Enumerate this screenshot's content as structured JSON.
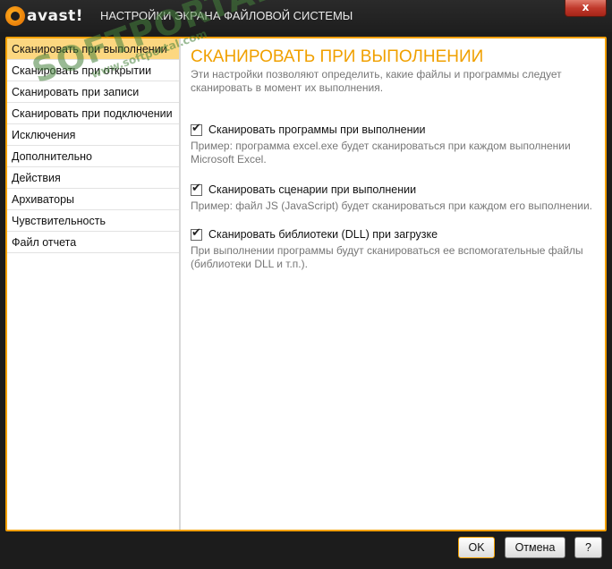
{
  "window": {
    "logo_text": "avast!",
    "title": "НАСТРОЙКИ ЭКРАНА ФАЙЛОВОЙ СИСТЕМЫ",
    "close_label": "x"
  },
  "sidebar": {
    "items": [
      {
        "label": "Сканировать при выполнении"
      },
      {
        "label": "Сканировать при открытии"
      },
      {
        "label": "Сканировать при записи"
      },
      {
        "label": "Сканировать при подключении"
      },
      {
        "label": "Исключения"
      },
      {
        "label": "Дополнительно"
      },
      {
        "label": "Действия"
      },
      {
        "label": "Архиваторы"
      },
      {
        "label": "Чувствительность"
      },
      {
        "label": "Файл отчета"
      }
    ]
  },
  "content": {
    "heading": "СКАНИРОВАТЬ ПРИ ВЫПОЛНЕНИИ",
    "intro": "Эти настройки позволяют определить, какие файлы и программы следует сканировать в момент их выполнения.",
    "options": [
      {
        "label": "Сканировать программы при выполнении",
        "description": "Пример: программа excel.exe будет сканироваться при каждом выполнении Microsoft Excel."
      },
      {
        "label": "Сканировать сценарии при выполнении",
        "description": "Пример: файл JS (JavaScript) будет сканироваться при каждом его выполнении."
      },
      {
        "label": "Сканировать библиотеки (DLL) при загрузке",
        "description": "При выполнении программы будут сканироваться ее вспомогательные файлы (библиотеки DLL и т.п.)."
      }
    ]
  },
  "buttons": {
    "ok": "OK",
    "cancel": "Отмена",
    "help": "?"
  },
  "watermark": {
    "main": "SOFTPORTAL",
    "url": "www.softportal.com"
  },
  "colors": {
    "accent": "#f2a000",
    "active_item": "#fcd780",
    "titlebar": "#1e1e1e"
  }
}
